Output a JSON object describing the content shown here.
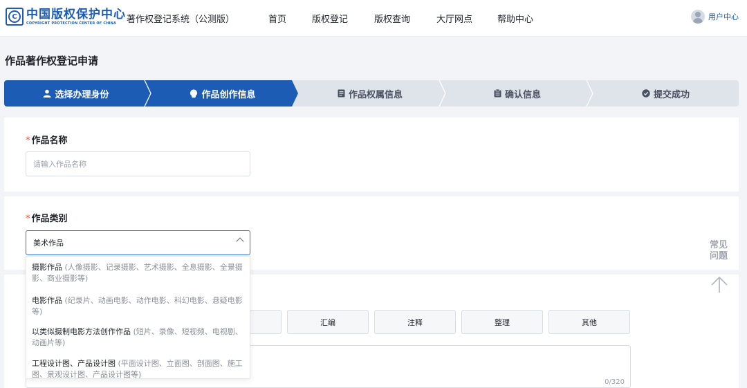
{
  "header": {
    "logo_cn": "中国版权保护中心",
    "logo_en": "COPYRIGHT PROTECTION CENTER OF CHINA",
    "logo_mark": "C",
    "system_name": "著作权登记系统（公测版）",
    "nav": [
      "首页",
      "版权登记",
      "版权查询",
      "大厅网点",
      "帮助中心"
    ],
    "user_label": "用户中心"
  },
  "page": {
    "title": "作品著作权登记申请"
  },
  "steps": [
    {
      "label": "选择办理身份",
      "icon": "user-icon",
      "state": "done"
    },
    {
      "label": "作品创作信息",
      "icon": "bulb-icon",
      "state": "active"
    },
    {
      "label": "作品权属信息",
      "icon": "document-icon",
      "state": "pending"
    },
    {
      "label": "确认信息",
      "icon": "clipboard-icon",
      "state": "pending"
    },
    {
      "label": "提交成功",
      "icon": "check-circle-icon",
      "state": "pending"
    }
  ],
  "form": {
    "required_mark": "*",
    "work_name": {
      "label": "作品名称",
      "placeholder": "请输入作品名称"
    },
    "work_category": {
      "label": "作品类别",
      "selected": "美术作品",
      "options": [
        {
          "name": "摄影作品",
          "desc": " (人像摄影、记录摄影、艺术摄影、全息摄影、全景摄影、商业摄影等)"
        },
        {
          "name": "电影作品",
          "desc": " (纪录片、动画电影、动作电影、科幻电影、悬疑电影等)"
        },
        {
          "name": "以类似摄制电影方法创作作品",
          "desc": " (短片、录像、短视频、电视剧、动画片等)"
        },
        {
          "name": "工程设计图、产品设计图",
          "desc": " (平面设计图、立面图、剖面图、施工图、景观设计图、产品设计图等)"
        }
      ]
    },
    "creation_types": [
      "汇编",
      "注释",
      "整理",
      "其他"
    ],
    "textarea_counter": "0/320"
  },
  "sidebar": {
    "faq": "常见问题"
  },
  "colors": {
    "primary": "#1d5cb4",
    "step_active": "#1d5cb4",
    "step_pending": "#dfe3ea",
    "required": "#e34d3b"
  }
}
